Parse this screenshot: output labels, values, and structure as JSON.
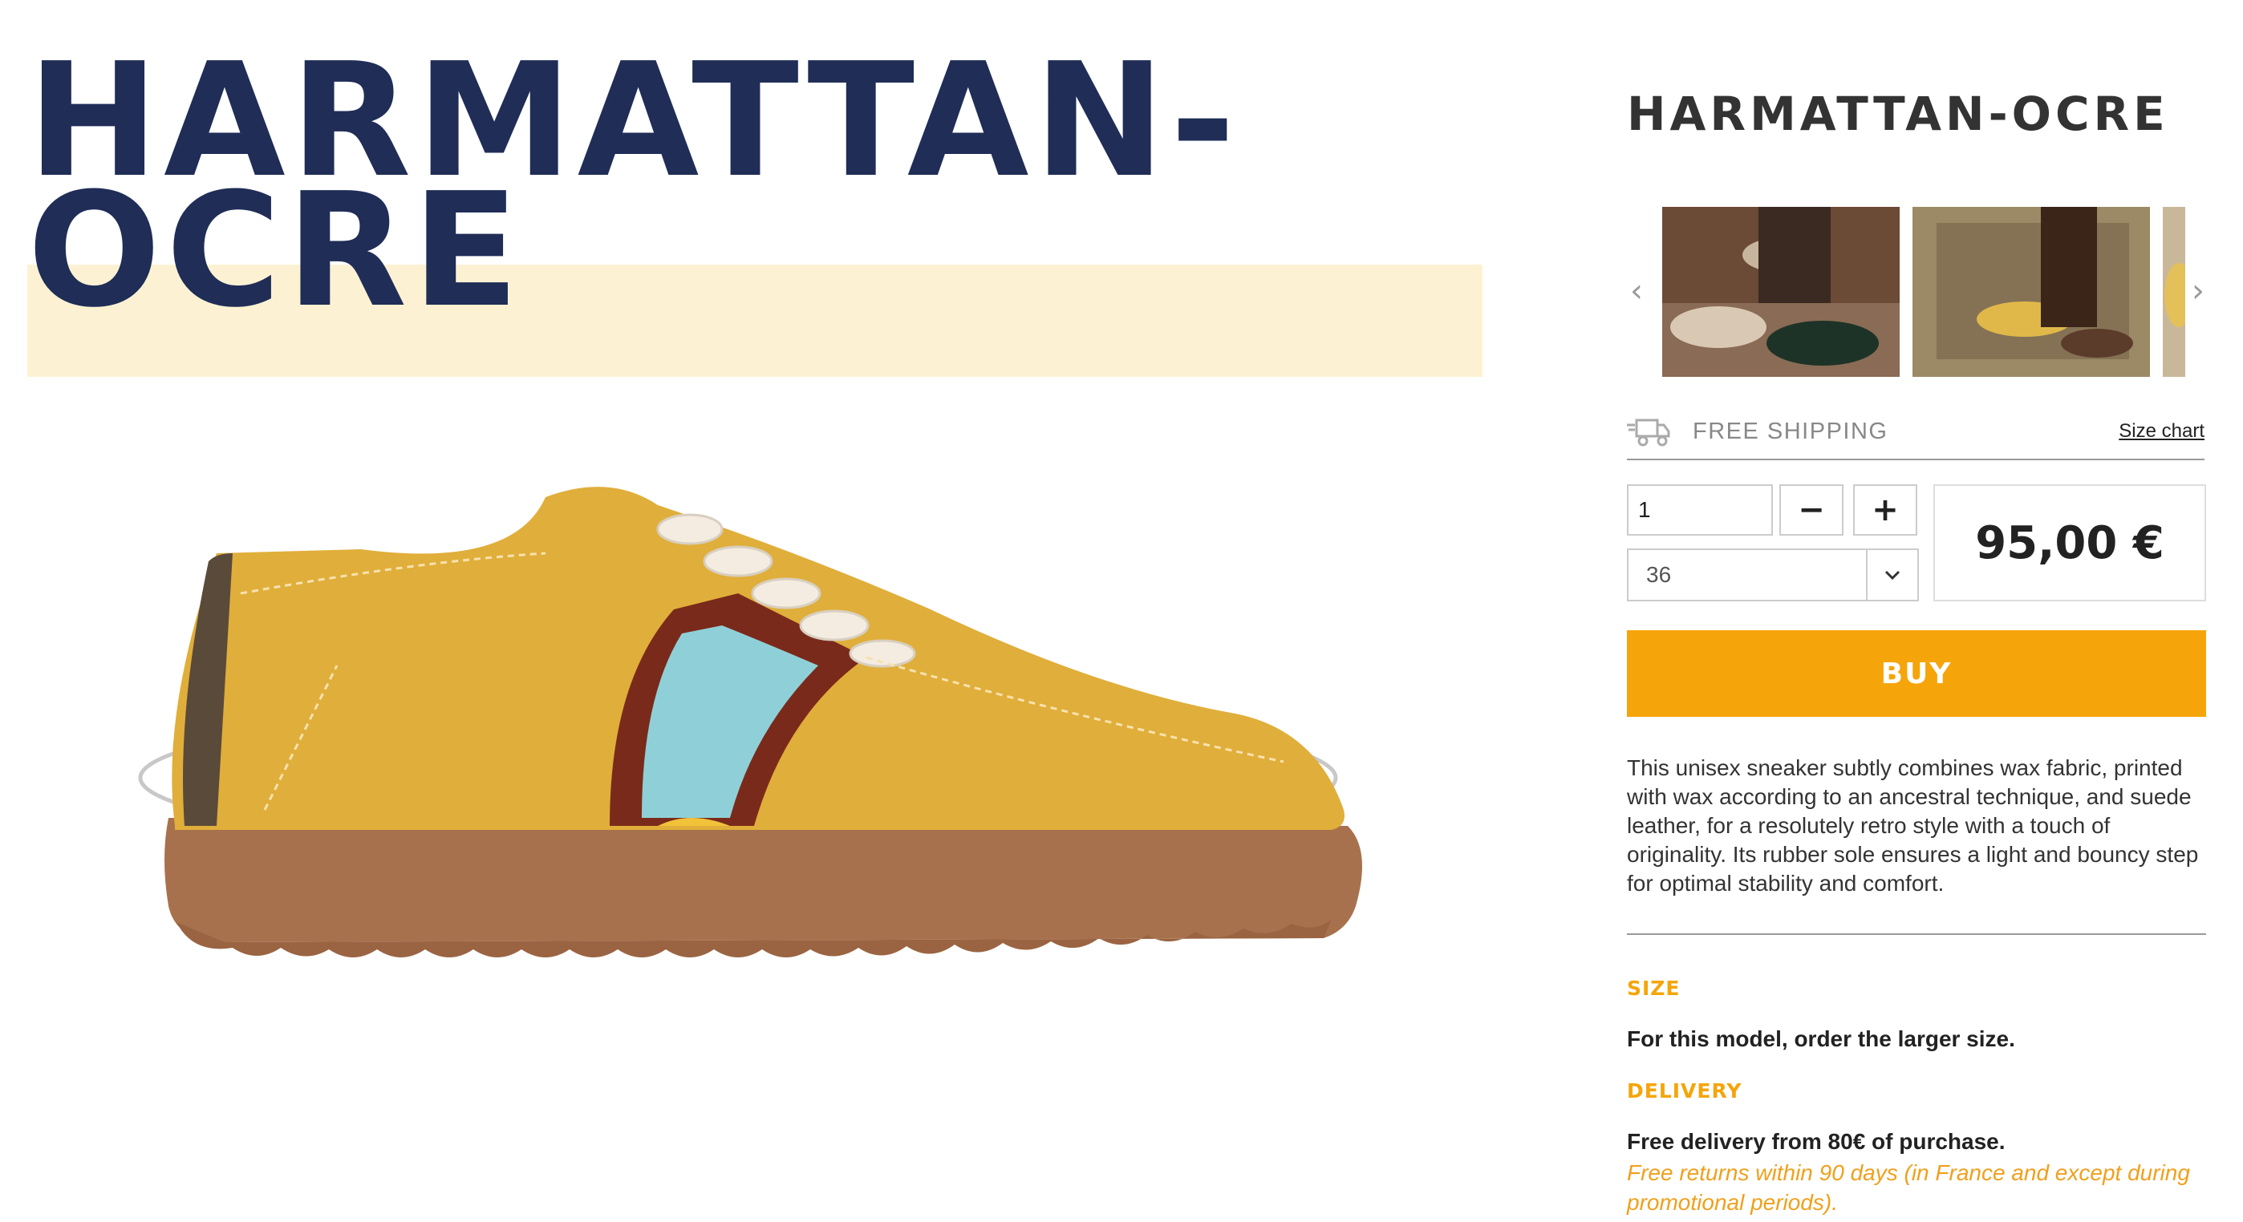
{
  "hero": {
    "title_line1": "HARMATTAN-",
    "title_line2": "OCRE",
    "title_color": "#1f2d57",
    "highlight_color": "#fcf2d3"
  },
  "product_image": {
    "alt": "HARMATTAN-OCRE",
    "icon": "sneaker-image"
  },
  "product": {
    "name": "HARMATTAN-OCRE",
    "price": "95,00 €",
    "description": "This unisex sneaker subtly combines wax fabric, printed with wax according to an ancestral technique, and suede leather, for a resolutely retro style with a touch of originality. Its rubber sole ensures a light and bouncy step for optimal stability and comfort."
  },
  "gallery": {
    "prev_icon": "‹",
    "next_icon": "›"
  },
  "shipping": {
    "label": "FREE SHIPPING",
    "icon": "truck-icon",
    "size_chart_link": "Size chart"
  },
  "quantity": {
    "value": "1",
    "minus": "−",
    "plus": "+"
  },
  "size_select": {
    "selected": "36"
  },
  "buy": {
    "label": "BUY",
    "color": "#f5a50a"
  },
  "sections": {
    "size_heading": "SIZE",
    "size_text": "For this model, order the larger size.",
    "delivery_heading": "DELIVERY",
    "delivery_text": "Free delivery from 80€ of purchase.",
    "returns_text": "Free returns within 90 days (in France and except during promotional periods)."
  },
  "colors": {
    "accent": "#f5a50a",
    "navy": "#1f2d57"
  }
}
